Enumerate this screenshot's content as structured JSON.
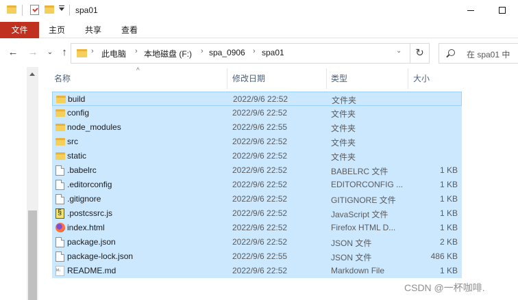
{
  "window": {
    "title": "spa01",
    "minimize_icon": "minimize-icon",
    "maximize_icon": "maximize-icon"
  },
  "ribbon": {
    "tabs": [
      {
        "label": "文件"
      },
      {
        "label": "主页"
      },
      {
        "label": "共享"
      },
      {
        "label": "查看"
      }
    ]
  },
  "address": {
    "crumbs": [
      "此电脑",
      "本地磁盘 (F:)",
      "spa_0906",
      "spa01"
    ],
    "search_placeholder": "在 spa01 中"
  },
  "columns": {
    "name": "名称",
    "date": "修改日期",
    "type": "类型",
    "size": "大小"
  },
  "files": [
    {
      "name": "build",
      "date": "2022/9/6 22:52",
      "type": "文件夹",
      "size": "",
      "icon": "folder-icon"
    },
    {
      "name": "config",
      "date": "2022/9/6 22:52",
      "type": "文件夹",
      "size": "",
      "icon": "folder-icon"
    },
    {
      "name": "node_modules",
      "date": "2022/9/6 22:55",
      "type": "文件夹",
      "size": "",
      "icon": "folder-icon"
    },
    {
      "name": "src",
      "date": "2022/9/6 22:52",
      "type": "文件夹",
      "size": "",
      "icon": "folder-icon"
    },
    {
      "name": "static",
      "date": "2022/9/6 22:52",
      "type": "文件夹",
      "size": "",
      "icon": "folder-icon"
    },
    {
      "name": ".babelrc",
      "date": "2022/9/6 22:52",
      "type": "BABELRC 文件",
      "size": "1 KB",
      "icon": "file-icon"
    },
    {
      "name": ".editorconfig",
      "date": "2022/9/6 22:52",
      "type": "EDITORCONFIG ...",
      "size": "1 KB",
      "icon": "file-icon"
    },
    {
      "name": ".gitignore",
      "date": "2022/9/6 22:52",
      "type": "GITIGNORE 文件",
      "size": "1 KB",
      "icon": "file-icon"
    },
    {
      "name": ".postcssrc.js",
      "date": "2022/9/6 22:52",
      "type": "JavaScript 文件",
      "size": "1 KB",
      "icon": "javascript-file-icon"
    },
    {
      "name": "index.html",
      "date": "2022/9/6 22:52",
      "type": "Firefox HTML D...",
      "size": "1 KB",
      "icon": "firefox-html-icon"
    },
    {
      "name": "package.json",
      "date": "2022/9/6 22:52",
      "type": "JSON 文件",
      "size": "2 KB",
      "icon": "file-icon"
    },
    {
      "name": "package-lock.json",
      "date": "2022/9/6 22:55",
      "type": "JSON 文件",
      "size": "486 KB",
      "icon": "file-icon"
    },
    {
      "name": "README.md",
      "date": "2022/9/6 22:52",
      "type": "Markdown File",
      "size": "1 KB",
      "icon": "markdown-file-icon"
    }
  ],
  "watermark": "CSDN @一杯咖啡."
}
